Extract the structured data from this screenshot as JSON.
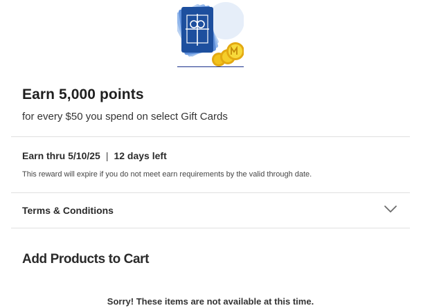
{
  "offer": {
    "image_icon": "gift-card-with-coins",
    "title": "Earn 5,000 points",
    "subtitle": "for every $50 you spend on select Gift Cards"
  },
  "earn": {
    "earn_thru": "Earn thru 5/10/25",
    "separator": "|",
    "days_left": "12 days left",
    "expire_note": "This reward will expire if you do not meet earn requirements by the valid through date."
  },
  "terms": {
    "label": "Terms & Conditions",
    "icon": "chevron-down-icon"
  },
  "products": {
    "title": "Add Products to Cart",
    "empty_message": "Sorry! These items are not available at this time."
  },
  "colors": {
    "card_blue": "#1d4f9e",
    "card_fan": "#8db4ea",
    "coin_gold": "#f2c21b",
    "divider": "#e0e0e0"
  }
}
